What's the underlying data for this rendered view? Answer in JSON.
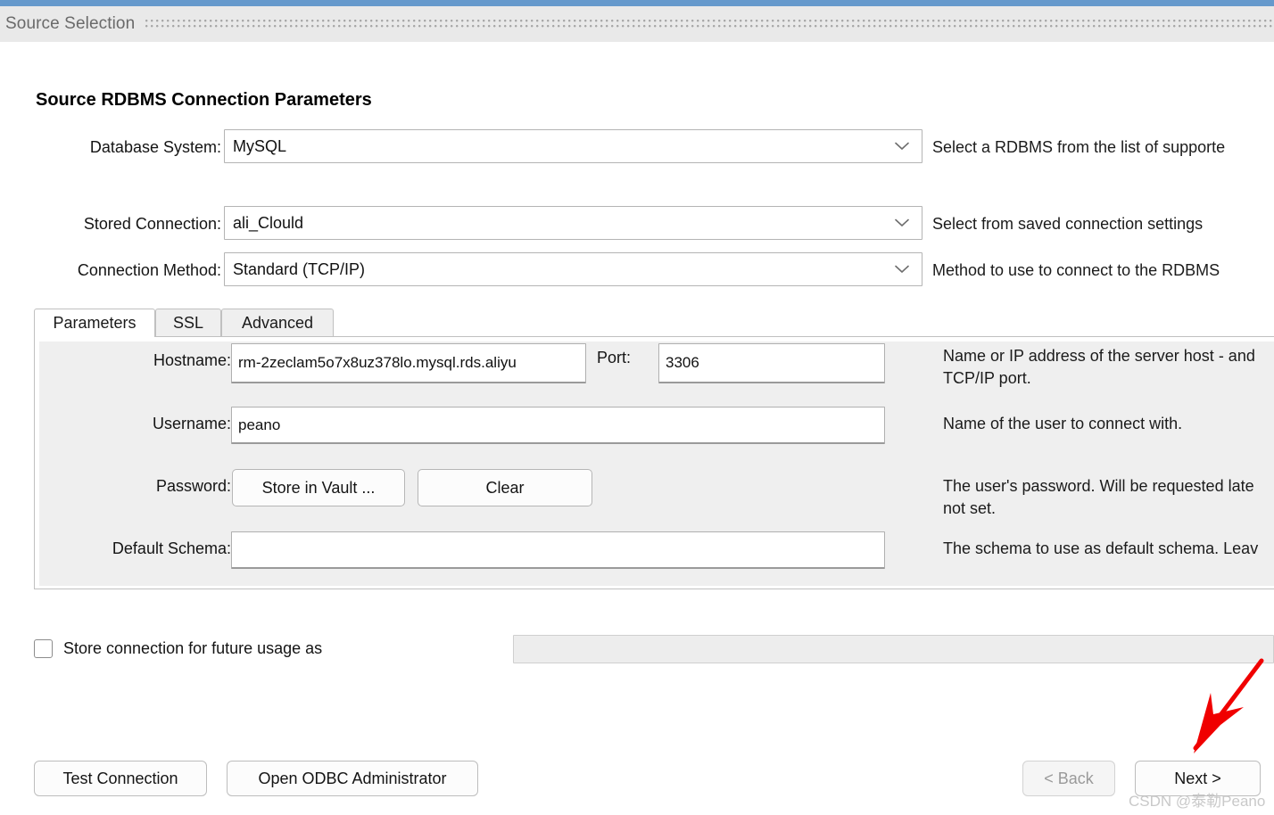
{
  "window": {
    "accent_color": "#6699cc",
    "header_title": "Source Selection"
  },
  "section": {
    "title": "Source RDBMS Connection Parameters"
  },
  "connection_rows": [
    {
      "label": "Database System:",
      "value": "MySQL",
      "help": "Select a RDBMS from the list of supporte"
    },
    {
      "label": "Stored Connection:",
      "value": "ali_Clould",
      "help": "Select from saved connection settings"
    },
    {
      "label": "Connection Method:",
      "value": "Standard (TCP/IP)",
      "help": "Method to use to connect to the RDBMS"
    }
  ],
  "tabs": [
    {
      "label": "Parameters",
      "active": true
    },
    {
      "label": "SSL",
      "active": false
    },
    {
      "label": "Advanced",
      "active": false
    }
  ],
  "parameters": {
    "hostname_label": "Hostname:",
    "hostname_value": "rm-2zeclam5o7x8uz378lo.mysql.rds.aliyu",
    "port_label": "Port:",
    "port_value": "3306",
    "hostname_help": "Name or IP address of the server host - and\nTCP/IP port.",
    "username_label": "Username:",
    "username_value": "peano",
    "username_help": "Name of the user to connect with.",
    "password_label": "Password:",
    "password_store_button": "Store in Vault ...",
    "password_clear_button": "Clear",
    "password_help": "The user's password. Will be requested late\nnot set.",
    "schema_label": "Default Schema:",
    "schema_value": "",
    "schema_help": "The schema to use as default schema. Leav"
  },
  "store_connection": {
    "label": "Store connection for future usage as",
    "checked": false,
    "input_value": ""
  },
  "footer": {
    "test_connection": "Test Connection",
    "open_odbc": "Open ODBC Administrator",
    "back": "< Back",
    "next": "Next >"
  },
  "annotation": {
    "arrow_color": "#f00000",
    "watermark": "CSDN @泰勒Peano"
  }
}
